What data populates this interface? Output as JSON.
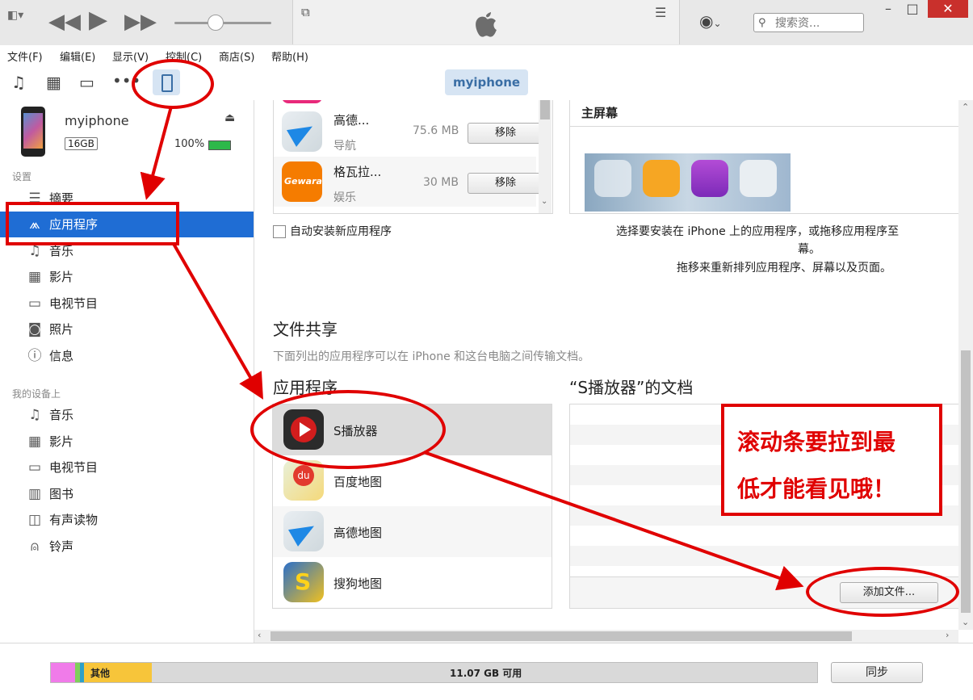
{
  "toolbar": {
    "search_placeholder": "搜索资...",
    "minimize": "–",
    "maximize": "□",
    "close": "✕"
  },
  "menu": [
    "文件(F)",
    "编辑(E)",
    "显示(V)",
    "控制(C)",
    "商店(S)",
    "帮助(H)"
  ],
  "media": {
    "device_label": "myiphone"
  },
  "device": {
    "name": "myiphone",
    "capacity": "16GB",
    "battery": "100%"
  },
  "sidebar": {
    "settings_header": "设置",
    "settings_items": [
      {
        "label": "摘要",
        "icon": "summary-icon"
      },
      {
        "label": "应用程序",
        "icon": "apps-icon"
      },
      {
        "label": "音乐",
        "icon": "music-icon"
      },
      {
        "label": "影片",
        "icon": "film-icon"
      },
      {
        "label": "电视节目",
        "icon": "tv-icon"
      },
      {
        "label": "照片",
        "icon": "camera-icon"
      },
      {
        "label": "信息",
        "icon": "info-icon"
      }
    ],
    "ondevice_header": "我的设备上",
    "ondevice_items": [
      {
        "label": "音乐",
        "icon": "music-icon"
      },
      {
        "label": "影片",
        "icon": "film-icon"
      },
      {
        "label": "电视节目",
        "icon": "tv-icon"
      },
      {
        "label": "图书",
        "icon": "book-icon"
      },
      {
        "label": "有声读物",
        "icon": "audiobook-icon"
      },
      {
        "label": "铃声",
        "icon": "bell-icon"
      }
    ]
  },
  "apps_list": [
    {
      "name": "高德...",
      "category": "导航",
      "size": "75.6 MB",
      "button": "移除"
    },
    {
      "name": "格瓦拉...",
      "category": "娱乐",
      "size": "30 MB",
      "button": "移除"
    }
  ],
  "auto_install_label": "自动安装新应用程序",
  "home_screen": {
    "title": "主屏幕",
    "desc_line1": "选择要安装在 iPhone 上的应用程序，或拖移应用程序至",
    "desc_line2": "幕。",
    "desc_line3": "拖移来重新排列应用程序、屏幕以及页面。"
  },
  "file_sharing": {
    "title": "文件共享",
    "desc": "下面列出的应用程序可以在 iPhone 和这台电脑之间传输文档。",
    "apps_header": "应用程序",
    "docs_header": "“S播放器”的文档",
    "apps": [
      "S播放器",
      "百度地图",
      "高德地图",
      "搜狗地图"
    ],
    "add_file_button": "添加文件..."
  },
  "annotation": {
    "line1": "滚动条要拉到最",
    "line2": "低才能看见哦！"
  },
  "storage": {
    "other_label": "其他",
    "free_label": "11.07 GB 可用",
    "sync_button": "同步"
  },
  "colors": {
    "accent": "#1f6dd4",
    "annotation_red": "#e00000"
  }
}
